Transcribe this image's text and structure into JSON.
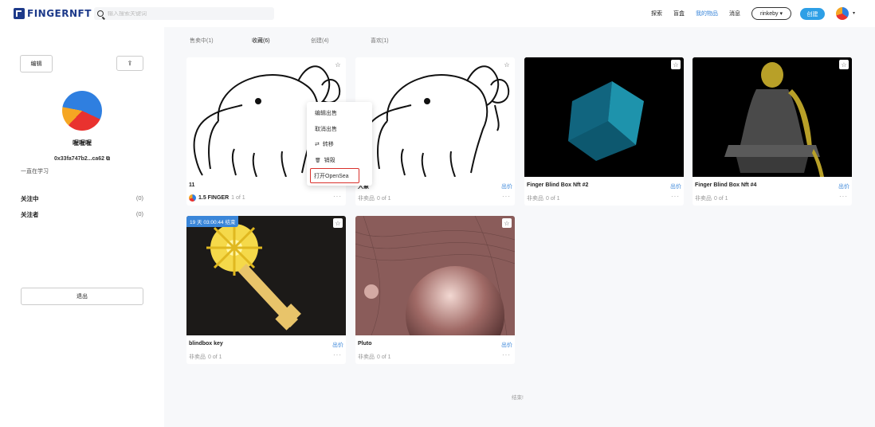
{
  "header": {
    "logo": "FINGERNFT",
    "search_placeholder": "输入搜索关键词",
    "nav": [
      "探索",
      "盲盒",
      "我的物品",
      "消息"
    ],
    "network": "rinkeby ▾",
    "create": "创建",
    "caret": "▾"
  },
  "sidebar": {
    "edit": "编辑",
    "share_icon": "⇪",
    "username": "喔喔喔",
    "address": "0x33fa747b2...ca62 ⧉",
    "bio": "一直在学习",
    "stats": [
      {
        "label": "关注中",
        "value": "(0)"
      },
      {
        "label": "关注者",
        "value": "(0)"
      }
    ],
    "logout": "退出"
  },
  "tabs": [
    "售卖中(1)",
    "收藏(6)",
    "创建(4)",
    "喜欢(1)"
  ],
  "cards": [
    {
      "title": "11",
      "sell": "",
      "price": "1.5 FINGER",
      "edition": "1 of 1",
      "more": "···",
      "star": "☆",
      "timer": ""
    },
    {
      "title": "大象",
      "sell": "出价",
      "price": "",
      "status": "非卖品",
      "edition": "0 of 1",
      "more": "···",
      "star": "☆",
      "timer": ""
    },
    {
      "title": "Finger Blind Box Nft #2",
      "sell": "出价",
      "price": "",
      "status": "非卖品",
      "edition": "0 of 1",
      "more": "···",
      "star": "☆",
      "timer": ""
    },
    {
      "title": "Finger Blind Box Nft #4",
      "sell": "出价",
      "price": "",
      "status": "非卖品",
      "edition": "0 of 1",
      "more": "···",
      "star": "☆",
      "timer": ""
    },
    {
      "title": "blindbox key",
      "sell": "出价",
      "price": "",
      "status": "非卖品",
      "edition": "0 of 1",
      "more": "···",
      "star": "☆",
      "timer": "19 天 03:00:44 结束"
    },
    {
      "title": "Pluto",
      "sell": "出价",
      "price": "",
      "status": "非卖品",
      "edition": "0 of 1",
      "more": "···",
      "star": "☆",
      "timer": ""
    }
  ],
  "context_menu": [
    {
      "icon": "",
      "label": "编辑出售"
    },
    {
      "icon": "",
      "label": "取消出售"
    },
    {
      "icon": "⇄",
      "label": "转移"
    },
    {
      "icon": "🗑",
      "label": "销毁"
    },
    {
      "icon": "",
      "label": "打开OpenSea"
    }
  ],
  "end_label": "结束!"
}
